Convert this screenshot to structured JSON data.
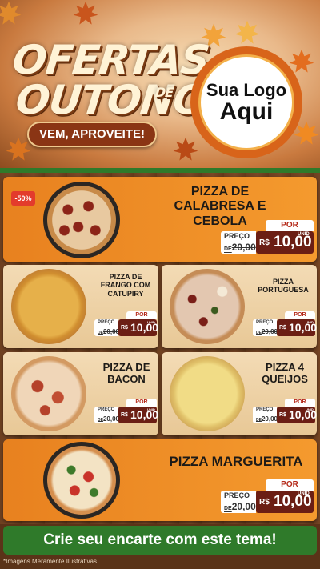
{
  "header": {
    "title_line1": "OFERTAS",
    "title_line2": "OUTONO",
    "title_de": "DE",
    "slogan": "VEM, APROVEITE!",
    "logo_line1": "Sua Logo",
    "logo_line2": "Aqui"
  },
  "products": [
    {
      "name": "PIZZA DE CALABRESA E CEBOLA",
      "badge": "-50%",
      "de_label": "PREÇO",
      "de_prefix": "DE",
      "old_price": "20,00",
      "por_label": "POR",
      "currency": "R$",
      "price": "10,00",
      "unit": "UNID",
      "pizza": "calabresa"
    },
    {
      "name": "PIZZA DE FRANGO COM CATUPIRY",
      "de_label": "PREÇO",
      "de_prefix": "DE",
      "old_price": "20,00",
      "por_label": "POR",
      "currency": "R$",
      "price": "10,00",
      "unit": "UNID",
      "pizza": "frango"
    },
    {
      "name": "PIZZA PORTUGUESA",
      "de_label": "PREÇO",
      "de_prefix": "DE",
      "old_price": "20,00",
      "por_label": "POR",
      "currency": "R$",
      "price": "10,00",
      "unit": "UNID",
      "pizza": "portuguesa"
    },
    {
      "name": "PIZZA DE BACON",
      "de_label": "PREÇO",
      "de_prefix": "DE",
      "old_price": "20,00",
      "por_label": "POR",
      "currency": "R$",
      "price": "10,00",
      "unit": "UNID",
      "pizza": "bacon"
    },
    {
      "name": "PIZZA 4 QUEIJOS",
      "de_label": "PREÇO",
      "de_prefix": "DE",
      "old_price": "20,00",
      "por_label": "POR",
      "currency": "R$",
      "price": "10,00",
      "unit": "UNID",
      "pizza": "queijos"
    },
    {
      "name": "PIZZA MARGUERITA",
      "de_label": "PREÇO",
      "de_prefix": "DE",
      "old_price": "20,00",
      "por_label": "POR",
      "currency": "R$",
      "price": "10,00",
      "unit": "UNID",
      "pizza": "marguerita"
    }
  ],
  "cta": "Crie seu encarte com este tema!",
  "disclaimer": "*Imagens Meramente Ilustrativas",
  "colors": {
    "orange_card": "#f0901f",
    "light_card": "#f0d6ad",
    "price_box": "#6b1e14",
    "por_text": "#b52a1a",
    "cta_green": "#2f7a2a",
    "badge_red": "#e33b2c"
  }
}
